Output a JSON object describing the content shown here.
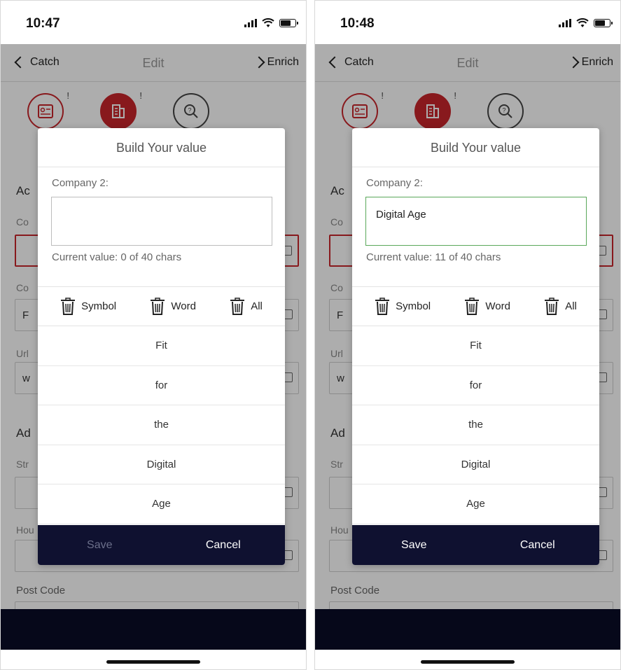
{
  "screens": [
    {
      "time": "10:47",
      "nav": {
        "back": "Catch",
        "title": "Edit",
        "next": "Enrich"
      },
      "background": {
        "section1_partial": "Ac",
        "label1_partial": "Co",
        "label2_partial": "Co",
        "field2_partial": "F",
        "label3_partial": "Url",
        "field3_partial": "w",
        "section2_partial": "Ad",
        "label4_partial": "Str",
        "label5_partial": "Hou",
        "post_code": "Post Code"
      },
      "modal": {
        "title": "Build Your value",
        "field_label": "Company 2:",
        "value": "",
        "char_count": "Current value: 0 of 40 chars",
        "actions": [
          "Symbol",
          "Word",
          "All"
        ],
        "words": [
          "Fit",
          "for",
          "the",
          "Digital",
          "Age"
        ],
        "save_label": "Save",
        "cancel_label": "Cancel",
        "save_enabled": false
      }
    },
    {
      "time": "10:48",
      "nav": {
        "back": "Catch",
        "title": "Edit",
        "next": "Enrich"
      },
      "background": {
        "section1_partial": "Ac",
        "label1_partial": "Co",
        "label2_partial": "Co",
        "field2_partial": "F",
        "label3_partial": "Url",
        "field3_partial": "w",
        "section2_partial": "Ad",
        "label4_partial": "Str",
        "label5_partial": "Hou",
        "post_code": "Post Code"
      },
      "modal": {
        "title": "Build Your value",
        "field_label": "Company 2:",
        "value": "Digital Age",
        "char_count": "Current value: 11 of 40 chars",
        "actions": [
          "Symbol",
          "Word",
          "All"
        ],
        "words": [
          "Fit",
          "for",
          "the",
          "Digital",
          "Age"
        ],
        "save_label": "Save",
        "cancel_label": "Cancel",
        "save_enabled": true
      }
    }
  ],
  "colors": {
    "accent_red": "#c9262b",
    "footer_navy": "#0f1130",
    "active_border": "#5aa85a"
  }
}
